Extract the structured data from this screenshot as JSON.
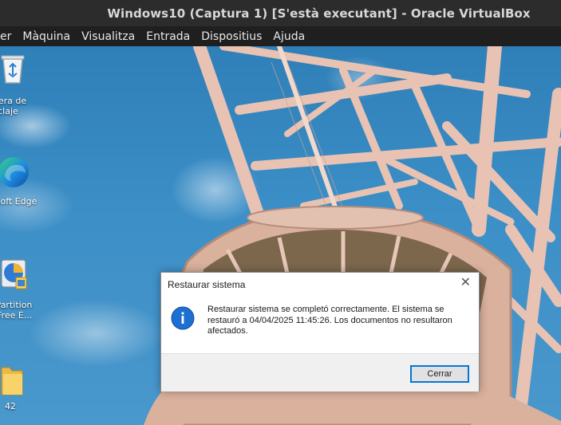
{
  "window": {
    "title": "Windows10 (Captura 1) [S'està executant] - Oracle VirtualBox"
  },
  "menu": [
    "er",
    "Màquina",
    "Visualitza",
    "Entrada",
    "Dispositius",
    "Ajuda"
  ],
  "desktop_icons": [
    {
      "label": "elera de\nciclaje",
      "icon": "recycle-bin-icon"
    },
    {
      "label": "osoft Edge",
      "icon": "edge-icon"
    },
    {
      "label": "l Partition\nr Free E...",
      "icon": "partition-tool-icon"
    },
    {
      "label": "42",
      "icon": "folder-icon"
    }
  ],
  "dialog": {
    "title": "Restaurar sistema",
    "message": "Restaurar sistema se completó correctamente. El sistema se restauró a 04/04/2025 11:45:26. Los documentos no resultaron afectados.",
    "button": "Cerrar",
    "icon": "info-icon"
  },
  "colors": {
    "accent": "#0078d7",
    "titlebar": "#2c2c2c",
    "menubar": "#1f1f1f"
  }
}
